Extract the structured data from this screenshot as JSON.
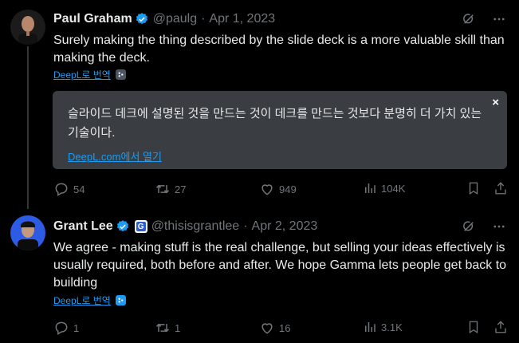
{
  "tweets": [
    {
      "name": "Paul Graham",
      "handle": "@paulg",
      "date": "Apr 1, 2023",
      "text": "Surely making the thing described by the slide deck is a more valuable skill than making the deck.",
      "deepl_label": "DeepL로 번역",
      "translation": {
        "text": "슬라이드 데크에 설명된 것을 만드는 것이 데크를 만드는 것보다 분명히 더 가치 있는 기술이다.",
        "link": "DeepL.com에서 열기",
        "close": "×"
      },
      "stats": {
        "replies": "54",
        "retweets": "27",
        "likes": "949",
        "views": "104K"
      }
    },
    {
      "name": "Grant Lee",
      "handle": "@thisisgrantlee",
      "date": "Apr 2, 2023",
      "badge_letter": "G",
      "text": "We agree - making stuff is the real challenge, but selling your ideas effectively is usually required, both before and after. We hope Gamma lets people get back to building",
      "deepl_label": "DeepL로 번역",
      "stats": {
        "replies": "1",
        "retweets": "1",
        "likes": "16",
        "views": "3.1K"
      }
    }
  ],
  "colors": {
    "background": "#000000",
    "accent": "#1d9bf0",
    "muted": "#71767b",
    "text": "#e7e9ea",
    "translation_box": "#3a3d41"
  },
  "icons": [
    "verified-badge-icon",
    "grok-icon",
    "more-icon",
    "deepl-icon",
    "reply-icon",
    "retweet-icon",
    "like-icon",
    "views-icon",
    "bookmark-icon",
    "share-icon"
  ]
}
